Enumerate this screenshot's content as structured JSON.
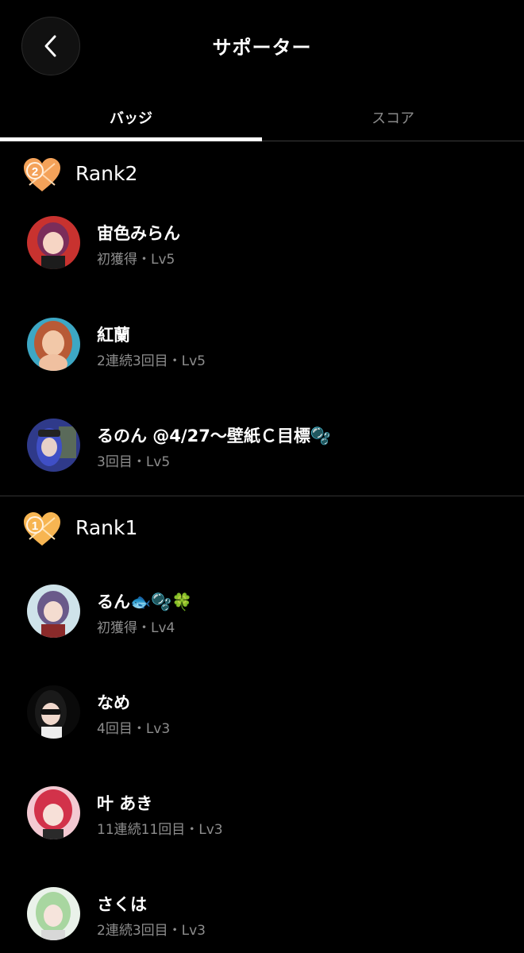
{
  "header": {
    "title": "サポーター"
  },
  "tabs": [
    {
      "label": "バッジ",
      "active": true
    },
    {
      "label": "スコア",
      "active": false
    }
  ],
  "ranks": [
    {
      "label": "Rank2",
      "badge_number": "2",
      "items": [
        {
          "name": "宙色みらん",
          "meta": "初獲得・Lv5"
        },
        {
          "name": "紅蘭",
          "meta": "2連続3回目・Lv5"
        },
        {
          "name": "るのん @4/27〜壁紙Ｃ目標🫧",
          "meta": "3回目・Lv5"
        }
      ]
    },
    {
      "label": "Rank1",
      "badge_number": "1",
      "items": [
        {
          "name": "るん🐟🫧🍀",
          "meta": "初獲得・Lv4"
        },
        {
          "name": "なめ",
          "meta": "4回目・Lv3"
        },
        {
          "name": "叶 あき",
          "meta": "11連続11回目・Lv3"
        },
        {
          "name": "さくは",
          "meta": "2連続3回目・Lv3"
        }
      ]
    }
  ],
  "colors": {
    "background": "#000000",
    "badge_orange": "#f4a259",
    "meta_gray": "#8d8d8d"
  }
}
